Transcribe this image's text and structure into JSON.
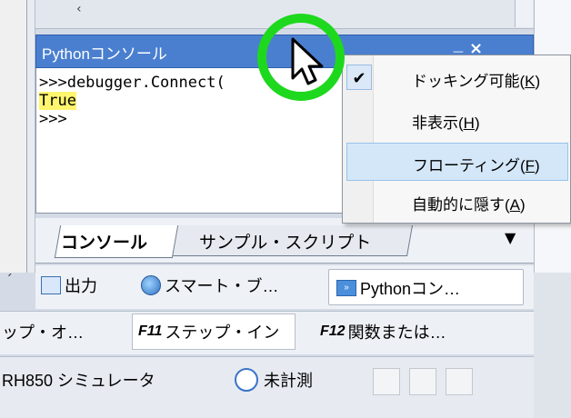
{
  "console": {
    "title": "Pythonコンソール",
    "lines": [
      ">>>debugger.Connect(",
      "True",
      ">>>"
    ]
  },
  "icons": {
    "pin": "ᅳ",
    "close": "×",
    "check": "✔",
    "dropdown": "▼",
    "top_arrow": "‹",
    "scroll_marker": "ˏ"
  },
  "tabs": {
    "active": "コンソール",
    "second": "サンプル・スクリプト"
  },
  "output_tabs": {
    "output": "出力",
    "smart": "スマート・ブ…",
    "python": "Pythonコン…"
  },
  "toolbar": {
    "step_over": "ップ・オ…",
    "step_in_key": "F11",
    "step_in": "ステップ・イン",
    "step_out_key": "F12",
    "step_out": "関数または…"
  },
  "status": {
    "target": "RH850 シミュレータ",
    "measure": "未計測"
  },
  "context_menu": {
    "items": [
      {
        "label": "ドッキング可能",
        "key": "K",
        "checked": true
      },
      {
        "label": "非表示",
        "key": "H",
        "checked": false
      },
      {
        "label": "フローティング",
        "key": "F",
        "checked": false,
        "highlighted": true
      },
      {
        "label": "自動的に隠す",
        "key": "A",
        "checked": false
      }
    ]
  },
  "colors": {
    "title_bar": "#4a7fd0",
    "highlight_text": "#fff56e",
    "ring": "#1ed81e",
    "menu_selected": "#d4e7f8"
  }
}
